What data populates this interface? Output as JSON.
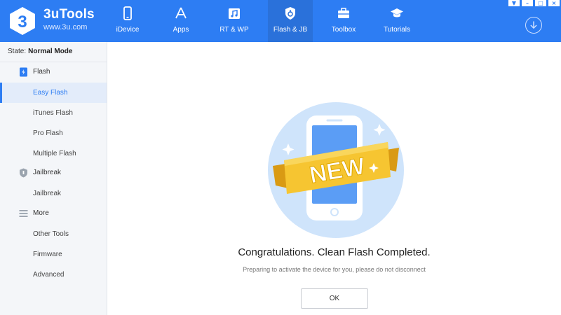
{
  "app": {
    "name": "3uTools",
    "url": "www.3u.com",
    "logo_glyph": "3"
  },
  "nav": {
    "items": [
      {
        "label": "iDevice",
        "icon": "phone-icon"
      },
      {
        "label": "Apps",
        "icon": "app-store-icon"
      },
      {
        "label": "RT & WP",
        "icon": "music-folder-icon"
      },
      {
        "label": "Flash & JB",
        "icon": "flash-shield-icon",
        "active": true
      },
      {
        "label": "Toolbox",
        "icon": "toolbox-icon"
      },
      {
        "label": "Tutorials",
        "icon": "graduation-cap-icon"
      }
    ]
  },
  "window_controls": {
    "pin": "▼",
    "minimize": "–",
    "maximize": "□",
    "close": "×"
  },
  "sidebar": {
    "state_label": "State:",
    "state_value": "Normal Mode",
    "groups": [
      {
        "label": "Flash",
        "icon": "flash-device-icon",
        "items": [
          {
            "label": "Easy Flash",
            "active": true
          },
          {
            "label": "iTunes Flash"
          },
          {
            "label": "Pro Flash"
          },
          {
            "label": "Multiple Flash"
          }
        ]
      },
      {
        "label": "Jailbreak",
        "icon": "jailbreak-shield-icon",
        "items": [
          {
            "label": "Jailbreak"
          }
        ]
      },
      {
        "label": "More",
        "icon": "menu-lines-icon",
        "items": [
          {
            "label": "Other Tools"
          },
          {
            "label": "Firmware"
          },
          {
            "label": "Advanced"
          }
        ]
      }
    ]
  },
  "main": {
    "illustration_badge": "NEW",
    "title": "Congratulations. Clean Flash Completed.",
    "subtitle": "Preparing to activate the device for you, please do not disconnect",
    "ok_label": "OK"
  },
  "colors": {
    "accent": "#2d7df3",
    "active_nav": "#2a71da",
    "ribbon": "#f6c531",
    "illustration_bg": "#cfe4fb"
  }
}
